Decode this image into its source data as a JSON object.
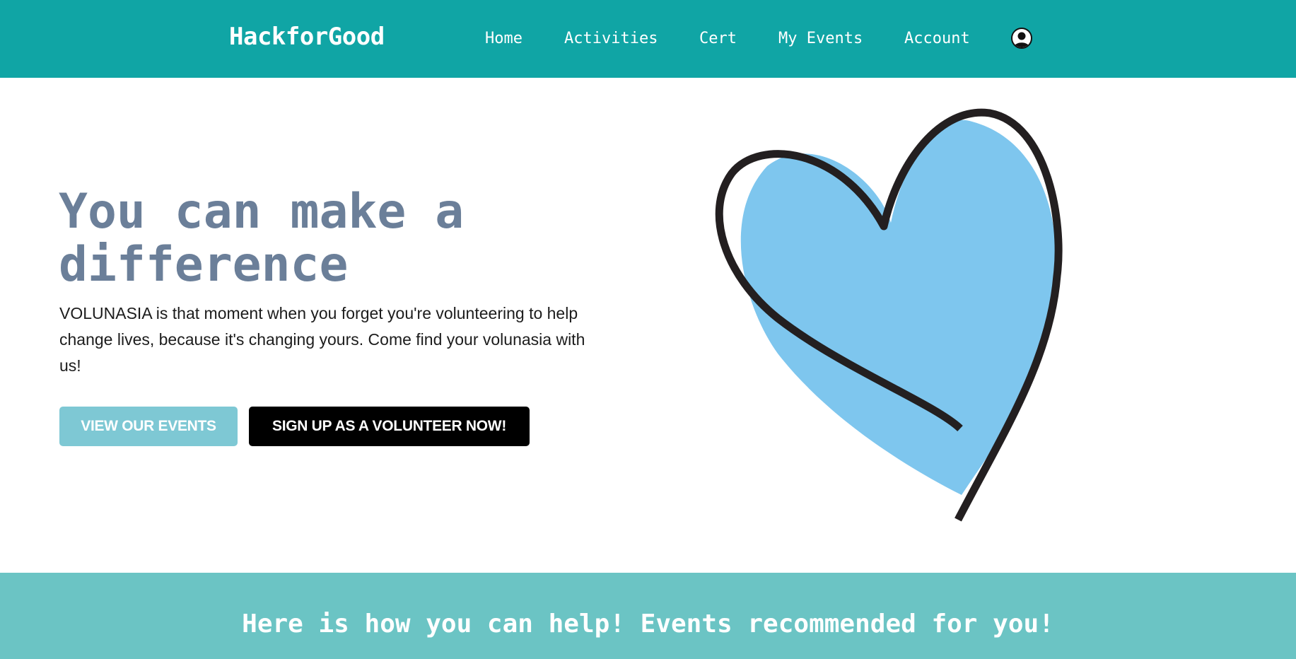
{
  "navbar": {
    "brand": "HackforGood",
    "links": [
      "Home",
      "Activities",
      "Cert",
      "My Events",
      "Account"
    ],
    "avatar_icon": "user-profile-icon",
    "background": "#10a5a5"
  },
  "hero": {
    "title": "You can make a difference",
    "description": "VOLUNASIA is that moment when you forget you're volunteering to help change lives, because it's changing yours. Come find your volunasia with us!",
    "view_events_label": "VIEW OUR EVENTS",
    "signup_label": "SIGN UP AS A VOLUNTEER NOW!",
    "illustration_icon": "heart-illustration",
    "title_color": "#6b7f99",
    "heart_fill": "#7ec6ee"
  },
  "recommendations": {
    "heading": "Here is how you can help! Events recommended for you!",
    "background": "#6bc4c4"
  }
}
